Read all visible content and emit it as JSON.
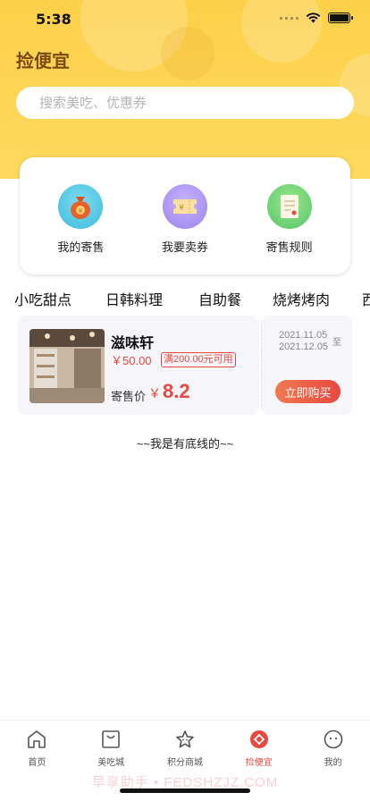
{
  "status_bar": {
    "time": "5:38"
  },
  "page": {
    "title": "捡便宜"
  },
  "search": {
    "placeholder": "搜索美吃、优惠券"
  },
  "actions": [
    {
      "label": "我的寄售",
      "icon": "money-bag-icon"
    },
    {
      "label": "我要卖券",
      "icon": "ticket-icon"
    },
    {
      "label": "寄售规则",
      "icon": "document-icon"
    }
  ],
  "categories": [
    "小吃甜点",
    "日韩料理",
    "自助餐",
    "烧烤烤肉",
    "西"
  ],
  "coupon": {
    "shop_name": "滋味轩",
    "price": "￥50.00",
    "min_spend": "满200.00元可用",
    "sale_label": "寄售价",
    "sale_currency": "￥",
    "sale_price": "8.2",
    "date_start": "2021.11.05",
    "date_to": "至",
    "date_end": "2021.12.05",
    "buy_label": "立即购买"
  },
  "footer_text": "~~我是有底线的~~",
  "tabbar": [
    {
      "label": "首页",
      "icon": "home-icon"
    },
    {
      "label": "美吃城",
      "icon": "bag-icon"
    },
    {
      "label": "积分商城",
      "icon": "star-icon"
    },
    {
      "label": "捡便宜",
      "icon": "diamond-icon",
      "active": true
    },
    {
      "label": "我的",
      "icon": "face-icon"
    }
  ],
  "watermark": "早享助手 • FEDSHZJZ.COM",
  "colors": {
    "accent": "#e8483e",
    "header": "#fdd04a",
    "title": "#7a4a10"
  }
}
